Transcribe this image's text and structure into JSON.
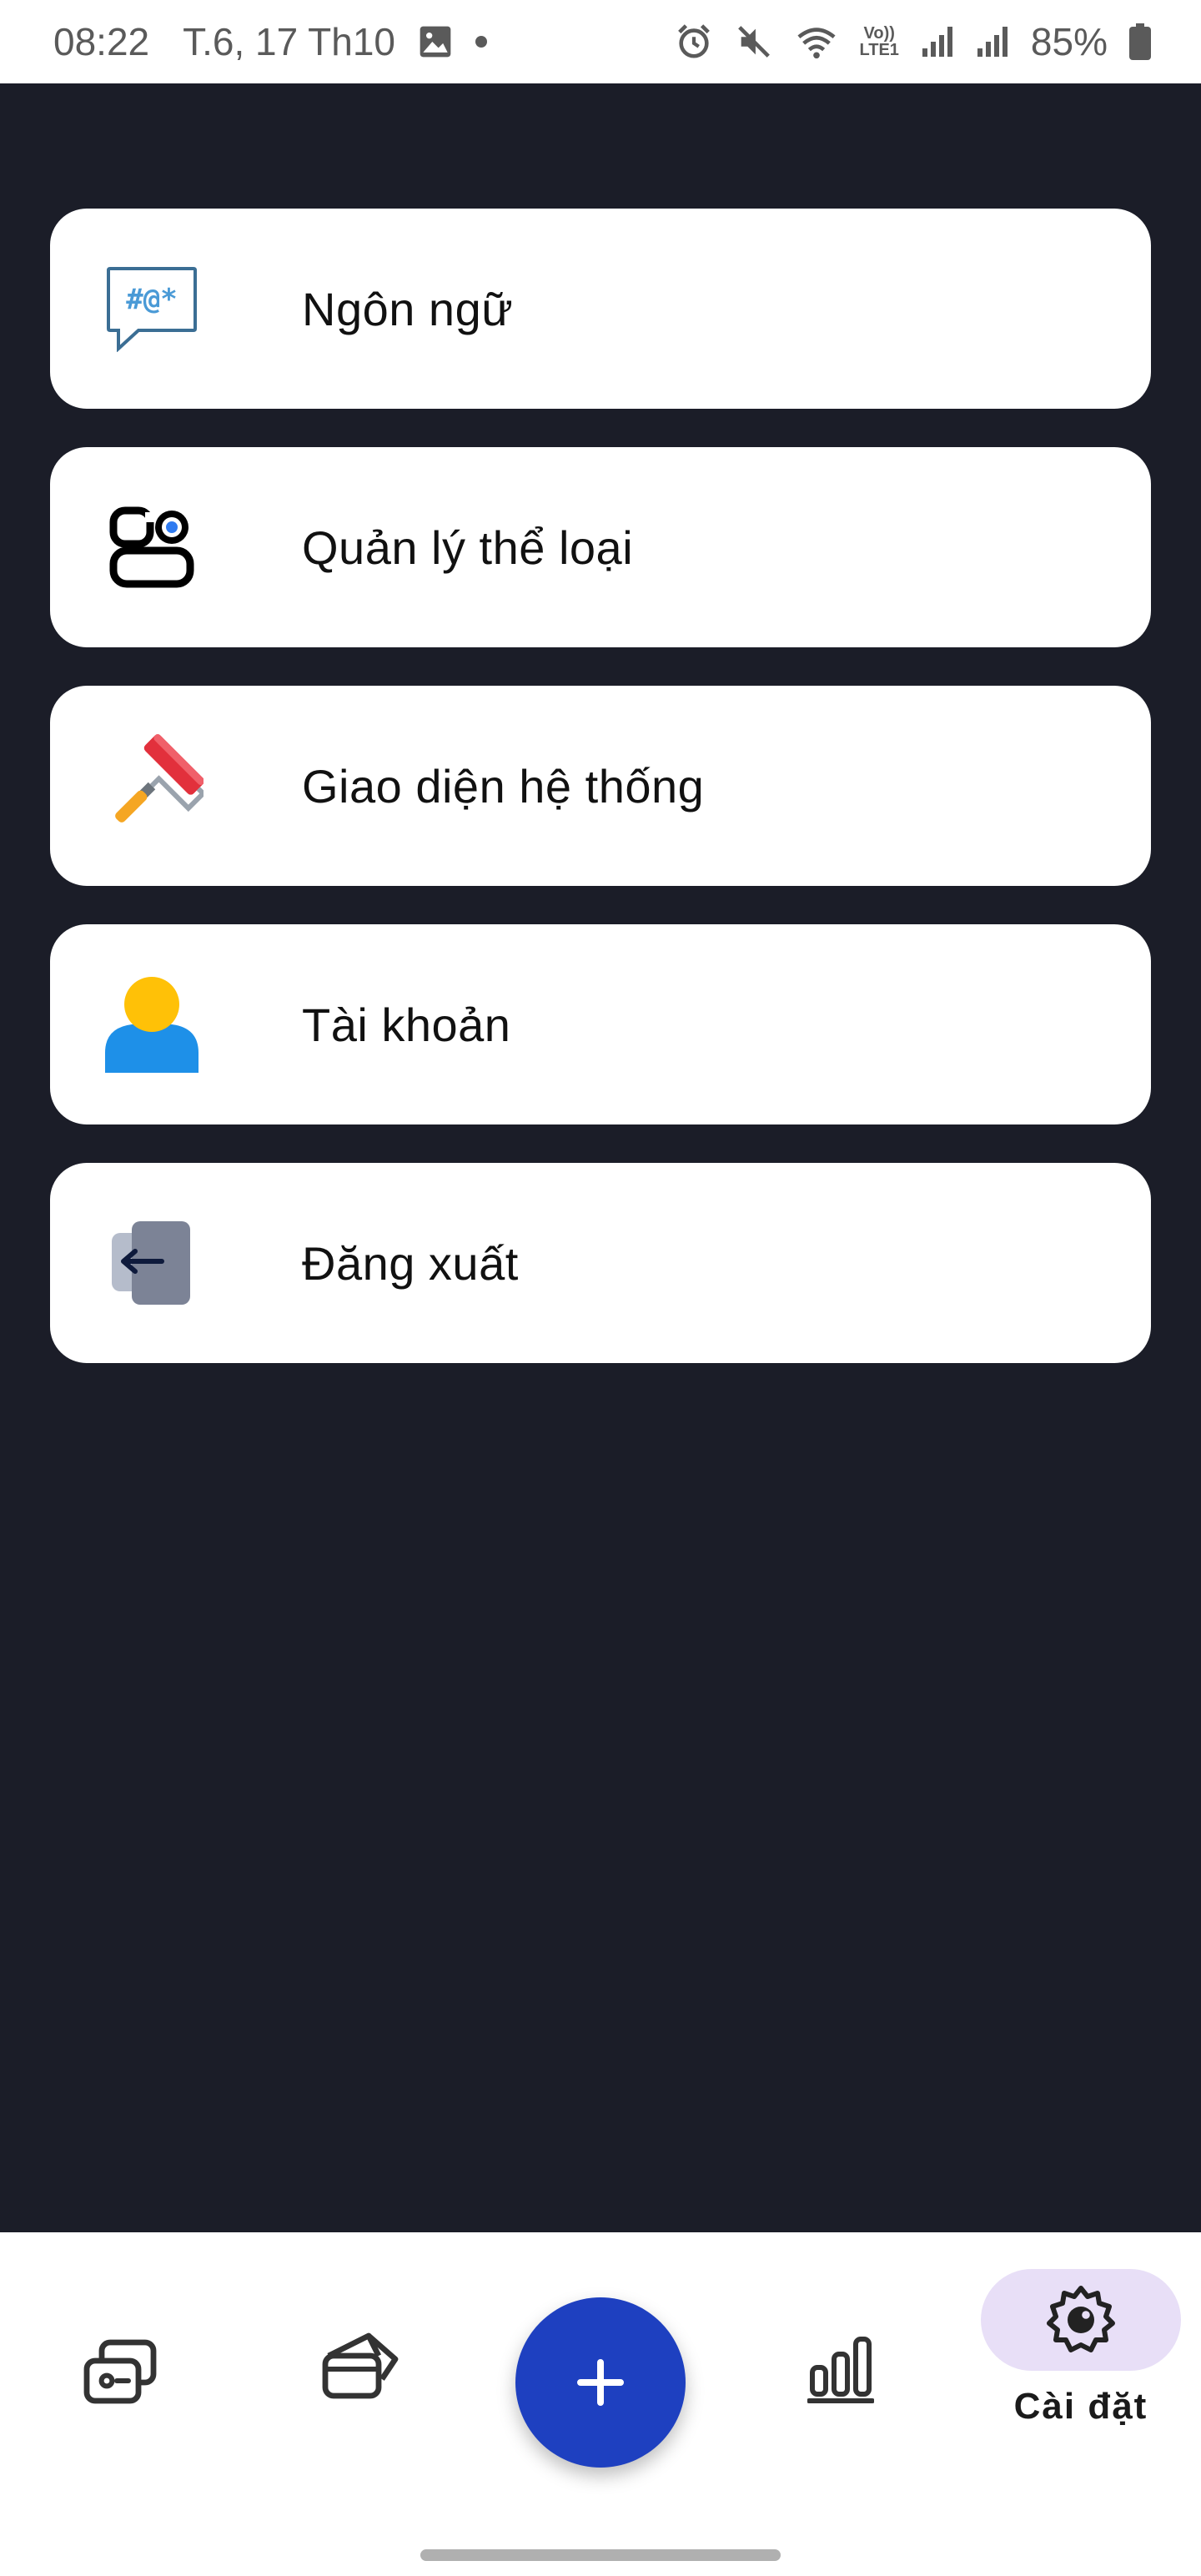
{
  "status_bar": {
    "time": "08:22",
    "date": "T.6, 17 Th10",
    "battery": "85%",
    "network_badge_top": "Vo))",
    "network_badge_bottom": "LTE1",
    "icons": [
      "image-icon",
      "dot-icon",
      "alarm-icon",
      "mute-icon",
      "wifi-icon",
      "signal-icon",
      "signal-icon",
      "battery-icon"
    ]
  },
  "settings": {
    "items": [
      {
        "label": "Ngôn ngữ",
        "icon": "language-chat-icon",
        "icon_text": "#@*"
      },
      {
        "label": "Quản lý thể loại",
        "icon": "category-manage-icon"
      },
      {
        "label": "Giao diện hệ thống",
        "icon": "paint-roller-icon"
      },
      {
        "label": "Tài khoản",
        "icon": "account-user-icon"
      },
      {
        "label": "Đăng xuất",
        "icon": "logout-icon"
      }
    ]
  },
  "bottom_nav": {
    "items": [
      {
        "icon": "transactions-icon"
      },
      {
        "icon": "wallet-icon"
      },
      {
        "icon": "add-icon"
      },
      {
        "icon": "stats-chart-icon"
      },
      {
        "icon": "settings-gear-icon",
        "label": "Cài đặt",
        "active": true
      }
    ]
  },
  "colors": {
    "background": "#1b1d28",
    "card": "#ffffff",
    "fab": "#1e40c0",
    "active_pill": "#e8dff7"
  }
}
